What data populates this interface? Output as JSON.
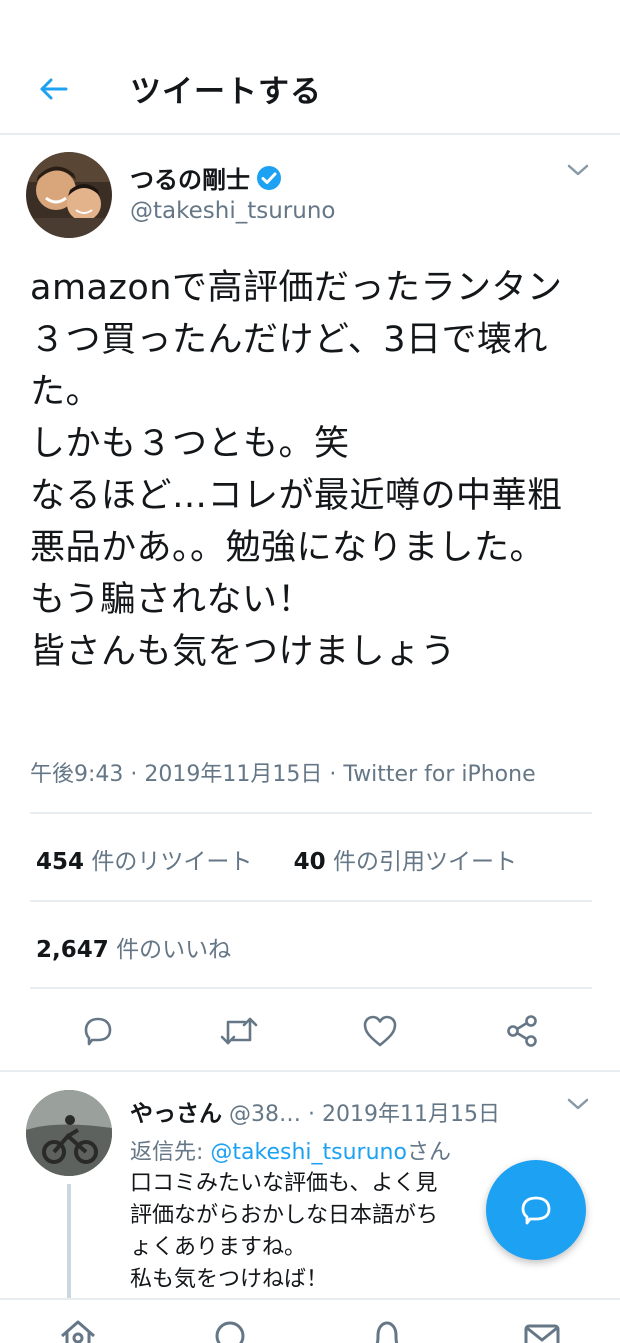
{
  "header": {
    "title": "ツイートする"
  },
  "tweet": {
    "author_name": "つるの剛士",
    "author_handle": "@takeshi_tsuruno",
    "text": "amazonで高評価だったランタン３つ買ったんだけど、3日で壊れた。\nしかも３つとも。笑\nなるほど…コレが最近噂の中華粗悪品かあ。。勉強になりました。\nもう騙されない！\n皆さんも気をつけましょう",
    "time": "午後9:43",
    "date": "2019年11月15日",
    "source": "Twitter for iPhone"
  },
  "stats": {
    "retweets_count": "454",
    "retweets_label": "件のリツイート",
    "quotes_count": "40",
    "quotes_label": "件の引用ツイート",
    "likes_count": "2,647",
    "likes_label": "件のいいね"
  },
  "reply": {
    "name": "やっさん",
    "handle": "@38…",
    "date": "2019年11月15日",
    "reply_to_prefix": "返信先: ",
    "reply_to_handle": "@takeshi_tsuruno",
    "reply_to_suffix": "さん",
    "text": "口コミみたいな評価も、よく見\n評価ながらおかしな日本語がち\nょくありますね。\n私も気をつけねば！"
  },
  "icons": {
    "back": "arrow-left-icon",
    "verified": "verified-badge-icon",
    "caret": "chevron-down-icon",
    "reply": "reply-icon",
    "retweet": "retweet-icon",
    "like": "heart-icon",
    "share": "share-icon",
    "compose": "compose-reply-icon",
    "home": "home-icon",
    "search": "search-icon",
    "notifications": "bell-icon",
    "messages": "mail-icon"
  },
  "colors": {
    "accent": "#1da1f2",
    "text": "#14171a",
    "secondary": "#657786",
    "divider": "#e6ecf0"
  }
}
